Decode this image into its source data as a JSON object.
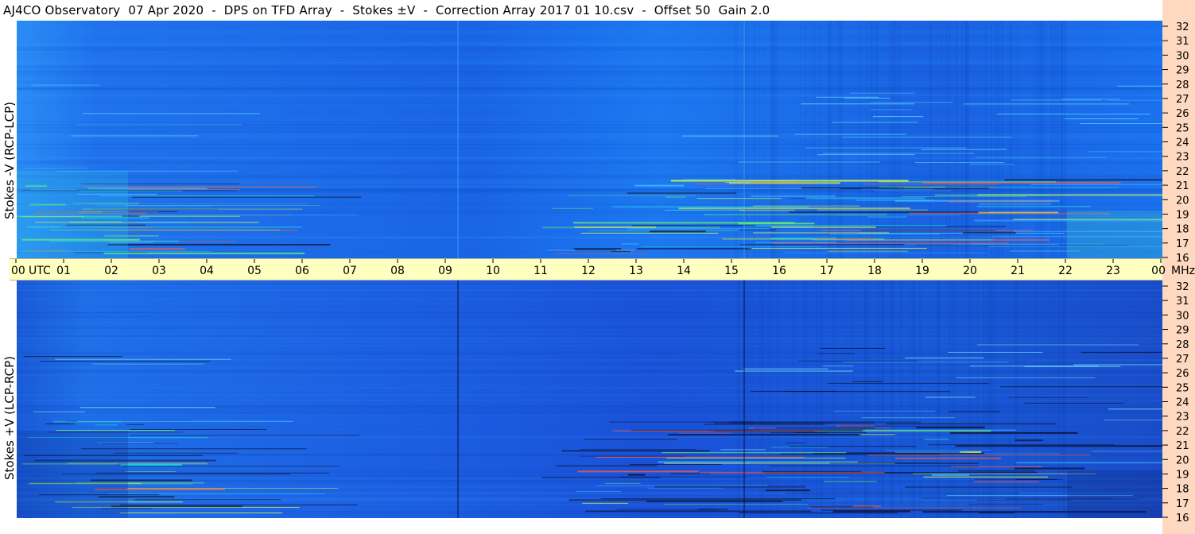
{
  "title": "AJ4CO Observatory  07 Apr 2020  -  DPS on TFD Array  -  Stokes ±V  -  Correction Array 2017 01 10.csv  -  Offset 50  Gain 2.0",
  "chart_data": [
    {
      "type": "heatmap",
      "panel": "top",
      "ylabel": "Stokes -V (RCP-LCP)",
      "y_ticks": [
        "16",
        "17",
        "18",
        "19",
        "20",
        "21",
        "22",
        "23",
        "24",
        "25",
        "26",
        "27",
        "28",
        "29",
        "30",
        "31",
        "32"
      ],
      "y_unit": "MHz",
      "ylim": [
        16,
        32
      ]
    },
    {
      "type": "heatmap",
      "panel": "bottom",
      "ylabel": "Stokes +V (LCP-RCP)",
      "y_ticks": [
        "16",
        "17",
        "18",
        "19",
        "20",
        "21",
        "22",
        "23",
        "24",
        "25",
        "26",
        "27",
        "28",
        "29",
        "30",
        "31",
        "32"
      ],
      "y_unit": "MHz",
      "ylim": [
        16,
        32
      ]
    }
  ],
  "x_axis": {
    "ticks": [
      "00",
      "01",
      "02",
      "03",
      "04",
      "05",
      "06",
      "07",
      "08",
      "09",
      "10",
      "11",
      "12",
      "13",
      "14",
      "15",
      "16",
      "17",
      "18",
      "19",
      "20",
      "21",
      "22",
      "23",
      "00"
    ],
    "unit_label": "UTC",
    "freq_unit": "MHz",
    "xlim": [
      0,
      24
    ]
  },
  "colors": {
    "background_top": "#1b6cf0",
    "background_bottom": "#1a58e0",
    "axis_bar": "#ffffc0",
    "right_strip": "#ffd9bf"
  }
}
